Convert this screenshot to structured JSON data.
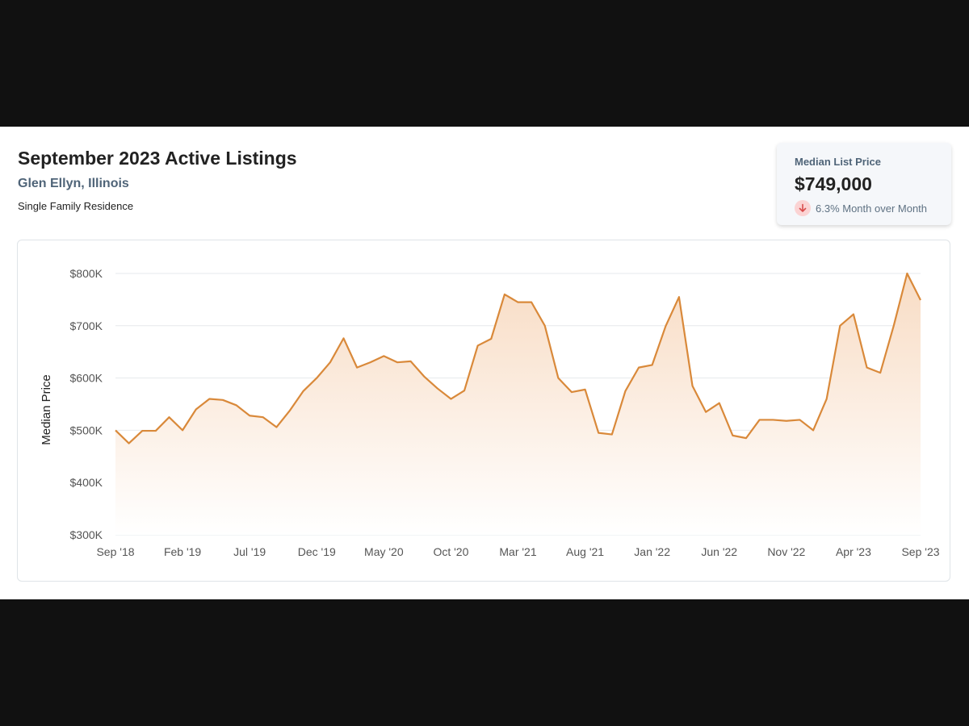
{
  "header": {
    "title": "September 2023 Active Listings",
    "location": "Glen Ellyn, Illinois",
    "property_type": "Single Family Residence"
  },
  "stat_card": {
    "label": "Median List Price",
    "value": "$749,000",
    "change_text": "6.3% Month over Month",
    "change_direction": "down",
    "icon": "arrow-down-icon"
  },
  "colors": {
    "line": "#d9893a",
    "fill_top": "#f8dcc4",
    "fill_bottom": "#ffffff",
    "grid": "#e6e9ec",
    "down_badge_bg": "#fbd3d3",
    "down_badge_fg": "#d84b4b"
  },
  "chart_data": {
    "type": "area",
    "title": "",
    "xlabel": "",
    "ylabel": "Median Price",
    "ylim": [
      300000,
      800000
    ],
    "y_ticks": [
      {
        "value": 300000,
        "label": "$300K"
      },
      {
        "value": 400000,
        "label": "$400K"
      },
      {
        "value": 500000,
        "label": "$500K"
      },
      {
        "value": 600000,
        "label": "$600K"
      },
      {
        "value": 700000,
        "label": "$700K"
      },
      {
        "value": 800000,
        "label": "$800K"
      }
    ],
    "x_ticks": [
      {
        "index": 0,
        "label": "Sep '18"
      },
      {
        "index": 5,
        "label": "Feb '19"
      },
      {
        "index": 10,
        "label": "Jul '19"
      },
      {
        "index": 15,
        "label": "Dec '19"
      },
      {
        "index": 20,
        "label": "May '20"
      },
      {
        "index": 25,
        "label": "Oct '20"
      },
      {
        "index": 30,
        "label": "Mar '21"
      },
      {
        "index": 35,
        "label": "Aug '21"
      },
      {
        "index": 40,
        "label": "Jan '22"
      },
      {
        "index": 45,
        "label": "Jun '22"
      },
      {
        "index": 50,
        "label": "Nov '22"
      },
      {
        "index": 55,
        "label": "Apr '23"
      },
      {
        "index": 60,
        "label": "Sep '23"
      }
    ],
    "grid": true,
    "legend": "none",
    "x_start": "Sep 2018",
    "x_end": "Sep 2023",
    "values": [
      500000,
      475000,
      499000,
      499000,
      525000,
      500000,
      540000,
      560000,
      558000,
      548000,
      528000,
      525000,
      506000,
      538000,
      575000,
      600000,
      630000,
      676000,
      620000,
      630000,
      642000,
      630000,
      632000,
      603000,
      580000,
      560000,
      576000,
      662000,
      675000,
      760000,
      745000,
      745000,
      700000,
      600000,
      573000,
      578000,
      495000,
      492000,
      575000,
      620000,
      625000,
      699000,
      755000,
      585000,
      535000,
      552000,
      490000,
      485000,
      520000,
      520000,
      518000,
      520000,
      500000,
      560000,
      700000,
      722000,
      620000,
      610000,
      700000,
      800000,
      749000
    ]
  }
}
